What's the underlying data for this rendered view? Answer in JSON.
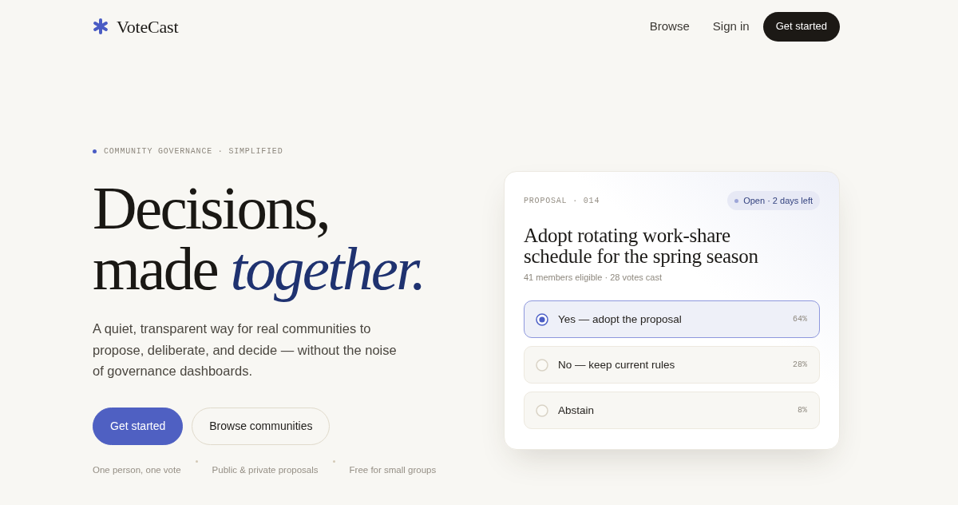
{
  "nav": {
    "logo": "VoteCast",
    "links": [
      {
        "label": "Browse"
      },
      {
        "label": "Sign in"
      }
    ],
    "cta": "Get started"
  },
  "hero": {
    "eyebrow": "COMMUNITY GOVERNANCE · SIMPLIFIED",
    "headline": [
      "Decisions,",
      "made *together.*"
    ],
    "lede": "A quiet, transparent way for real communities to propose, deliberate, and decide — without the noise of governance dashboards.",
    "buttons": [
      {
        "label": "Get started",
        "kind": "primary"
      },
      {
        "label": "Browse communities",
        "kind": "secondary"
      }
    ],
    "features": [
      "One person, one vote",
      "Public & private proposals",
      "Free for small groups"
    ]
  },
  "proposal_card": {
    "label": "PROPOSAL · 014",
    "status": "Open · 2 days left",
    "title": "Adopt rotating work-share schedule for the spring season",
    "meta": "41 members eligible · 28 votes cast",
    "options": [
      {
        "label": "Yes — adopt the proposal",
        "share": "64%",
        "selected": true
      },
      {
        "label": "No — keep current rules",
        "share": "28%",
        "selected": false
      },
      {
        "label": "Abstain",
        "share": "8%",
        "selected": false
      }
    ]
  }
}
